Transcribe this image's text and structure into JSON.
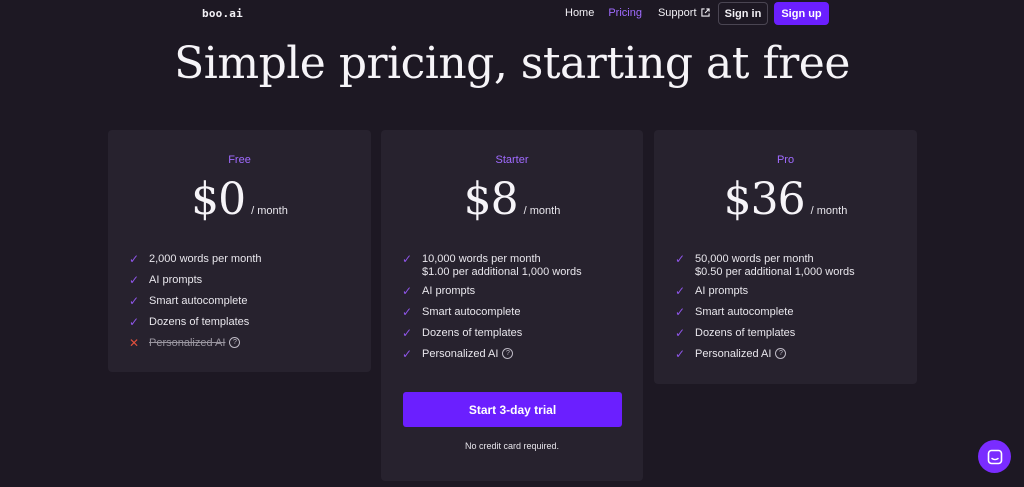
{
  "header": {
    "logo": "boo.ai",
    "nav": {
      "home": "Home",
      "pricing": "Pricing",
      "support": "Support"
    },
    "signin": "Sign in",
    "signup": "Sign up"
  },
  "hero": {
    "title": "Simple pricing, starting at free"
  },
  "plans": {
    "free": {
      "name": "Free",
      "price": "$0",
      "period": "/ month",
      "features": [
        "2,000 words per month",
        "AI prompts",
        "Smart autocomplete",
        "Dozens of templates",
        "Personalized AI"
      ]
    },
    "starter": {
      "name": "Starter",
      "price": "$8",
      "period": "/ month",
      "features": [
        "10,000 words per month",
        "$1.00 per additional 1,000 words",
        "AI prompts",
        "Smart autocomplete",
        "Dozens of templates",
        "Personalized AI"
      ],
      "cta": "Start 3-day trial",
      "note": "No credit card required."
    },
    "pro": {
      "name": "Pro",
      "price": "$36",
      "period": "/ month",
      "features": [
        "50,000 words per month",
        "$0.50 per additional 1,000 words",
        "AI prompts",
        "Smart autocomplete",
        "Dozens of templates",
        "Personalized AI"
      ]
    }
  },
  "icons": {
    "check": "check-icon",
    "cross": "cross-icon",
    "help": "?",
    "chat": "chat-icon",
    "external": "external-link-icon"
  },
  "colors": {
    "accent": "#6b1fff",
    "accent_text": "#a06bff",
    "background": "#1d1823",
    "card": "#27222e",
    "cross": "#e0503d"
  }
}
